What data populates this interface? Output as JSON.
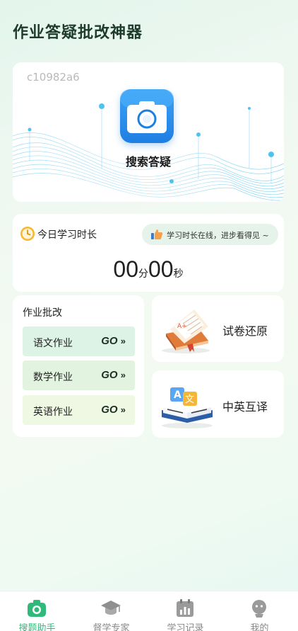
{
  "app": {
    "title": "作业答疑批改神器"
  },
  "search_card": {
    "code": "c10982a6",
    "label": "搜索答疑",
    "icon": "camera-icon"
  },
  "study_time": {
    "label": "今日学习时长",
    "encourage": "学习时长在线，进步看得见 ~",
    "minutes": "00",
    "minute_unit": "分",
    "seconds": "00",
    "second_unit": "秒"
  },
  "homework": {
    "title": "作业批改",
    "go_label": "GO",
    "go_arrow": "»",
    "items": [
      {
        "label": "语文作业",
        "color": "#dcf3e6"
      },
      {
        "label": "数学作业",
        "color": "#e2f4e0"
      },
      {
        "label": "英语作业",
        "color": "#eef8e3"
      }
    ]
  },
  "features": [
    {
      "label": "试卷还原",
      "icon": "test-paper-icon"
    },
    {
      "label": "中英互译",
      "icon": "translate-book-icon"
    }
  ],
  "nav": [
    {
      "label": "搜题助手",
      "icon": "camera-tab-icon",
      "active": true
    },
    {
      "label": "督学专家",
      "icon": "graduation-cap-icon",
      "active": false
    },
    {
      "label": "学习记录",
      "icon": "calendar-chart-icon",
      "active": false
    },
    {
      "label": "我的",
      "icon": "profile-icon",
      "active": false
    }
  ],
  "colors": {
    "accent": "#2fb97b",
    "camera_blue": "#1e7fe3",
    "title": "#1e3b2c"
  }
}
